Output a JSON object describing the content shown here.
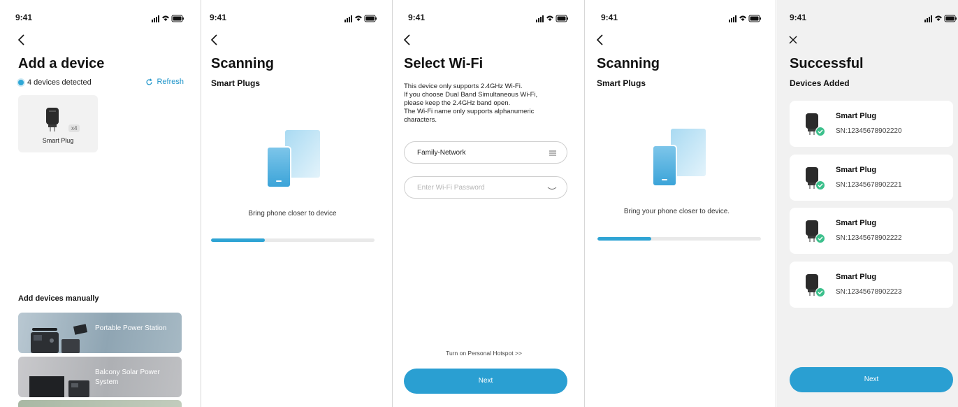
{
  "status_bar": {
    "time": "9:41"
  },
  "screen1": {
    "title": "Add a device",
    "detected": "4 devices detected",
    "refresh": "Refresh",
    "device": {
      "name": "Smart Plug",
      "count": "x4"
    },
    "manual_title": "Add devices manually",
    "manual_items": [
      {
        "label": "Portable Power Station"
      },
      {
        "label": "Balcony Solar Power System"
      }
    ]
  },
  "screen2": {
    "title": "Scanning",
    "subtitle": "Smart Plugs",
    "message": "Bring phone closer to device",
    "progress": 0.33
  },
  "screen3": {
    "title": "Select Wi-Fi",
    "description": [
      "This device only supports 2.4GHz Wi-Fi.",
      "If you choose Dual Band Simultaneous Wi-Fi,",
      "please keep the 2.4GHz band open.",
      "The Wi-Fi name only supports alphanumeric",
      "characters."
    ],
    "network_value": "Family-Network",
    "password_placeholder": "Enter Wi-Fi Password",
    "hotspot_link": "Turn on Personal Hotspot >>",
    "next": "Next"
  },
  "screen4": {
    "title": "Scanning",
    "subtitle": "Smart Plugs",
    "message": "Bring your phone closer to device.",
    "progress": 0.33
  },
  "screen5": {
    "title": "Successful",
    "subtitle": "Devices Added",
    "devices": [
      {
        "name": "Smart Plug",
        "sn": "SN:12345678902220"
      },
      {
        "name": "Smart Plug",
        "sn": "SN:12345678902221"
      },
      {
        "name": "Smart Plug",
        "sn": "SN:12345678902222"
      },
      {
        "name": "Smart Plug",
        "sn": "SN:12345678902223"
      }
    ],
    "next": "Next"
  },
  "colors": {
    "accent": "#2a9fd2",
    "success": "#3cc08c"
  },
  "icons": [
    "back-chevron-icon",
    "refresh-icon",
    "list-icon",
    "eye-closed-icon",
    "close-icon",
    "signal-icon",
    "wifi-icon",
    "battery-icon",
    "check-icon"
  ]
}
